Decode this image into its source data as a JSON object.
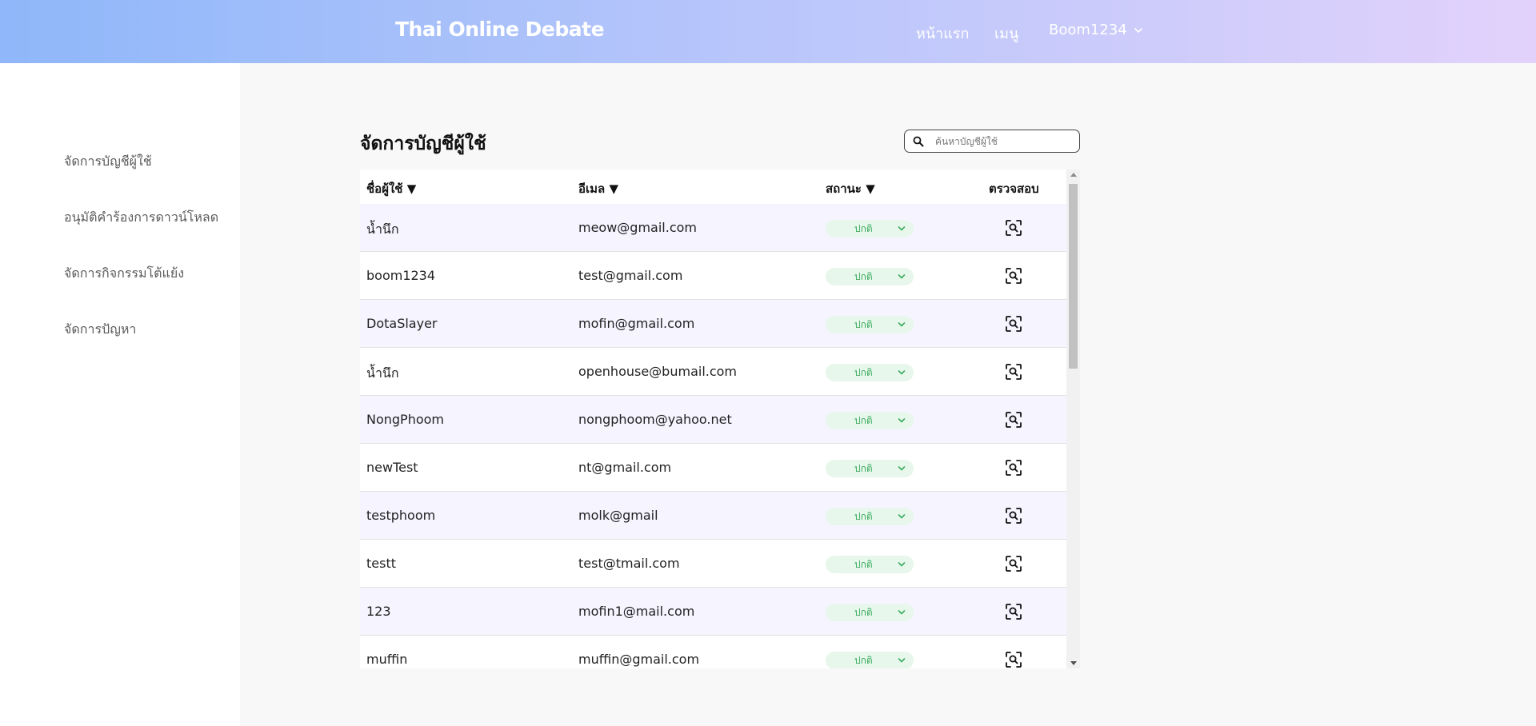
{
  "app": {
    "title": "Thai Online Debate"
  },
  "nav": {
    "home": "หน้าแรก",
    "menu": "เมนู",
    "user": "Boom1234"
  },
  "sidebar": {
    "items": [
      {
        "label": "จัดการบัญชีผู้ใช้"
      },
      {
        "label": "อนุมัติคำร้องการดาวน์โหลด"
      },
      {
        "label": "จัดการกิจกรรมโต้แย้ง"
      },
      {
        "label": "จัดการปัญหา"
      }
    ]
  },
  "page": {
    "title": "จัดการบัญชีผู้ใช้"
  },
  "search": {
    "placeholder": "ค้นหาบัญชีผู้ใช้",
    "icon": "search-icon"
  },
  "table": {
    "headers": {
      "username": "ชื่อผู้ใช้ ▼",
      "email": "อีเมล ▼",
      "status": "สถานะ ▼",
      "inspect": "ตรวจสอบ"
    },
    "rows": [
      {
        "username": "น้ำนึก",
        "email": "meow@gmail.com",
        "status": "ปกติ"
      },
      {
        "username": "boom1234",
        "email": "test@gmail.com",
        "status": "ปกติ"
      },
      {
        "username": "DotaSlayer",
        "email": "mofin@gmail.com",
        "status": "ปกติ"
      },
      {
        "username": "น้ำนึก",
        "email": "openhouse@bumail.com",
        "status": "ปกติ"
      },
      {
        "username": "NongPhoom",
        "email": "nongphoom@yahoo.net",
        "status": "ปกติ"
      },
      {
        "username": "newTest",
        "email": "nt@gmail.com",
        "status": "ปกติ"
      },
      {
        "username": "testphoom",
        "email": "molk@gmail",
        "status": "ปกติ"
      },
      {
        "username": "testt",
        "email": "test@tmail.com",
        "status": "ปกติ"
      },
      {
        "username": "123",
        "email": "mofin1@mail.com",
        "status": "ปกติ"
      },
      {
        "username": "muffin",
        "email": "muffin@gmail.com",
        "status": "ปกติ"
      }
    ]
  },
  "colors": {
    "header_gradient_start": "#8fb7f9",
    "header_gradient_end": "#e2d2fb",
    "row_alt": "#f5f4ff",
    "status_bg": "#e8f7ec",
    "status_text": "#3cac5f"
  }
}
